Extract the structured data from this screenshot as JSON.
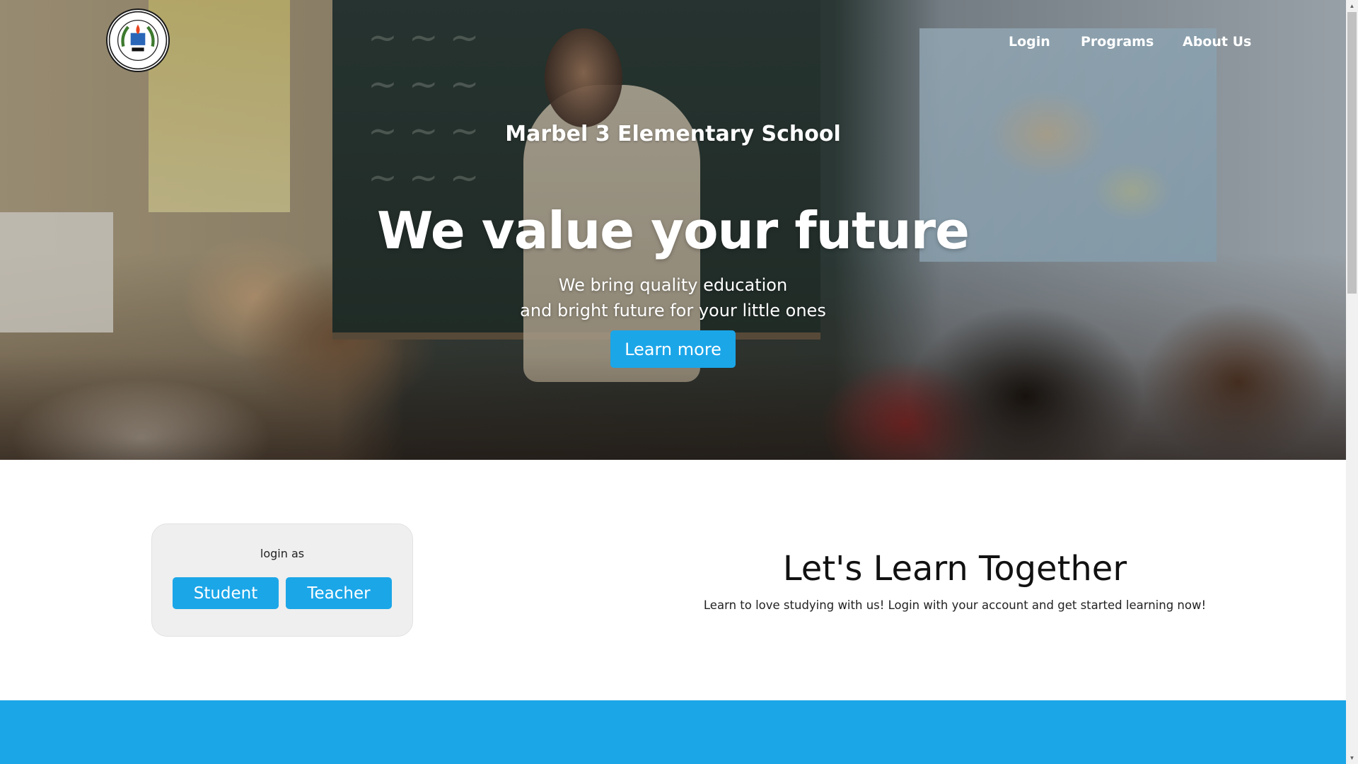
{
  "nav": {
    "login": "Login",
    "programs": "Programs",
    "about": "About Us"
  },
  "logo": {
    "icon": "school-seal-logo",
    "top_text": "MARBEL 3 ELEMENTARY SCHOOL",
    "bottom_text": "CITY OF KORONADAL",
    "year": "1945"
  },
  "hero": {
    "school_name": "Marbel 3 Elementary School",
    "title": "We value your future",
    "subtitle_line1": "We bring quality education",
    "subtitle_line2": "and bright future for your little ones",
    "cta": "Learn more"
  },
  "login_card": {
    "prompt": "login as",
    "student": "Student",
    "teacher": "Teacher"
  },
  "learn": {
    "heading": "Let's Learn Together",
    "description": "Learn to love studying with us! Login with your account and get started learning now!"
  },
  "colors": {
    "accent": "#1ba6e8",
    "card_bg": "#efefef"
  }
}
